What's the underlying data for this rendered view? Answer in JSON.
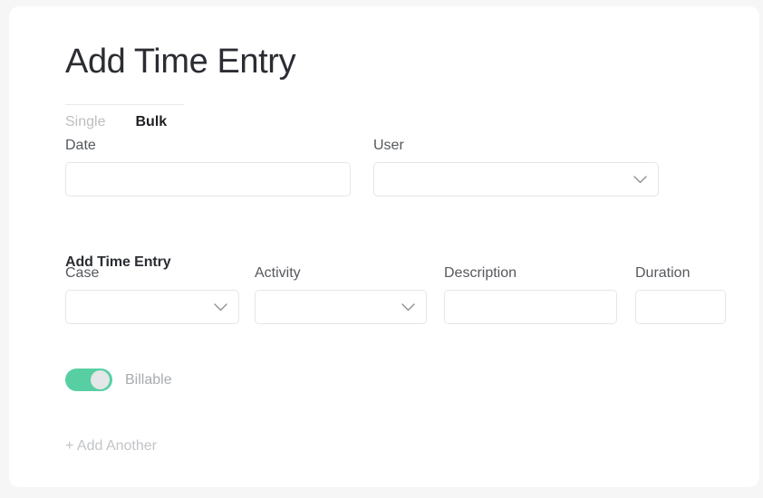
{
  "page": {
    "title": "Add Time Entry",
    "background_color": "#f6f6f7",
    "card_color": "#ffffff"
  },
  "tabs": [
    {
      "label": "Single",
      "active": false
    },
    {
      "label": "Bulk",
      "active": true
    }
  ],
  "top_fields": {
    "date": {
      "label": "Date",
      "value": "",
      "placeholder": "",
      "type": "text"
    },
    "user": {
      "label": "User",
      "value": "",
      "placeholder": "",
      "type": "select",
      "icon": "chevron-down-icon"
    }
  },
  "entry_section": {
    "heading": "Add Time Entry",
    "fields": {
      "case": {
        "label": "Case",
        "value": "",
        "placeholder": "",
        "type": "select",
        "icon": "chevron-down-icon"
      },
      "activity": {
        "label": "Activity",
        "value": "",
        "placeholder": "",
        "type": "select",
        "icon": "chevron-down-icon"
      },
      "description": {
        "label": "Description",
        "value": "",
        "placeholder": "",
        "type": "text"
      },
      "duration": {
        "label": "Duration",
        "value": "",
        "placeholder": "",
        "type": "text"
      }
    },
    "billable": {
      "label": "Billable",
      "state": "on",
      "on_color": "#57cfa3",
      "knob_color": "#e4e6e8"
    }
  },
  "actions": {
    "add_another": "+ Add Another"
  },
  "colors": {
    "title": "#2b2d33",
    "label": "#55585d",
    "muted": "#bdbec1",
    "border": "#e4e6e8",
    "accent": "#57cfa3"
  }
}
